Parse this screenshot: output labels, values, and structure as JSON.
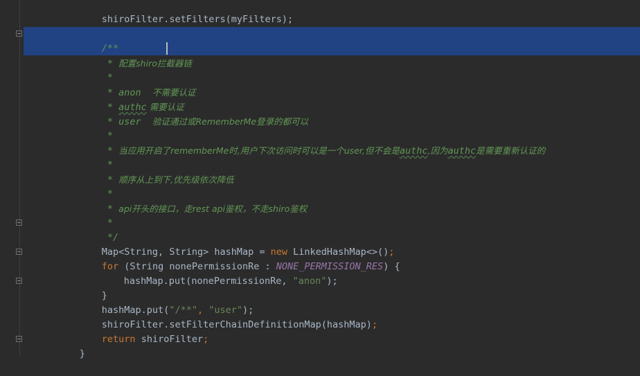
{
  "editor": {
    "lines": {
      "set_filters": "shiroFilter.setFilters(myFilters);",
      "doc_open": "/**",
      "doc_title_star": " * ",
      "doc_title_text": "配置shiro拦截器链",
      "star": " *",
      "anon_prefix": " * anon  ",
      "anon_desc": "不需要认证",
      "authc_prefix": " * ",
      "authc_word": "authc",
      "authc_desc": " 需要认证",
      "user_prefix": " * user  ",
      "user_desc": "验证通过或RememberMe登录的都可以",
      "remember_prefix": " * ",
      "remember_desc_a": "当应用开启了rememberMe时,用户下次访问时可以是一个user,但不会是",
      "remember_authc1": "authc",
      "remember_desc_b": ",因为",
      "remember_authc2": "authc",
      "remember_desc_c": "是需要重新认证的",
      "order_prefix": " * ",
      "order_desc": "顺序从上到下,优先级依次降低",
      "api_prefix": " * ",
      "api_desc": "api开头的接口，走rest api鉴权，不走shiro鉴权",
      "doc_close": " */",
      "map_decl_a": "Map<String, String> hashMap = ",
      "map_decl_new": "new",
      "map_decl_b": " LinkedHashMap<>()",
      "map_decl_semi": ";",
      "for_kw": "for",
      "for_a": " (String nonePermissionRe : ",
      "for_const": "NONE_PERMISSION_RES",
      "for_b": ") {",
      "put_a": "hashMap.put(nonePermissionRe, ",
      "put_str": "\"anon\"",
      "put_b": ");",
      "close_brace": "}",
      "put_user_a": "hashMap.put(",
      "put_user_str1": "\"/**\"",
      "put_user_comma": ", ",
      "put_user_str2": "\"user\"",
      "put_user_b": ");",
      "set_chain": "shiroFilter.setFilterChainDefinitionMap(hashMap)",
      "set_chain_semi": ";",
      "return_kw": "return",
      "return_val": " shiroFilter",
      "return_semi": ";",
      "method_close": "}"
    }
  },
  "colors": {
    "background": "#2b2b2b",
    "selection": "#214283",
    "keyword": "#cc7832",
    "string": "#6a8759",
    "doc_comment": "#629755",
    "constant": "#9876aa"
  }
}
